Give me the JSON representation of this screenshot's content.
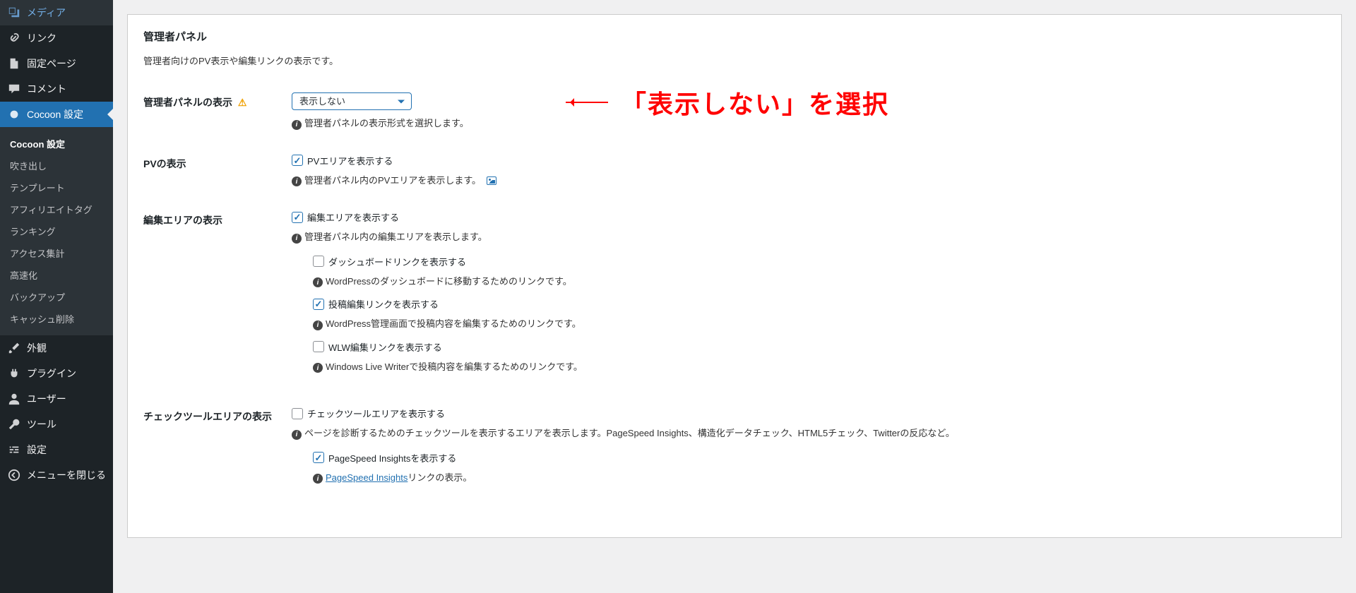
{
  "sidebar": {
    "items": [
      {
        "label": "メディア",
        "icon": "media"
      },
      {
        "label": "リンク",
        "icon": "link"
      },
      {
        "label": "固定ページ",
        "icon": "page"
      },
      {
        "label": "コメント",
        "icon": "comment"
      },
      {
        "label": "Cocoon 設定",
        "icon": "dot",
        "active": true
      },
      {
        "label": "外観",
        "icon": "brush"
      },
      {
        "label": "プラグイン",
        "icon": "plug"
      },
      {
        "label": "ユーザー",
        "icon": "user"
      },
      {
        "label": "ツール",
        "icon": "tool"
      },
      {
        "label": "設定",
        "icon": "settings"
      },
      {
        "label": "メニューを閉じる",
        "icon": "collapse"
      }
    ],
    "submenu": {
      "head": "Cocoon 設定",
      "items": [
        "吹き出し",
        "テンプレート",
        "アフィリエイトタグ",
        "ランキング",
        "アクセス集計",
        "高速化",
        "バックアップ",
        "キャッシュ削除"
      ]
    }
  },
  "panel": {
    "title": "管理者パネル",
    "desc": "管理者向けのPV表示や編集リンクの表示です。"
  },
  "rows": {
    "display": {
      "label": "管理者パネルの表示",
      "select_value": "表示しない",
      "hint": "管理者パネルの表示形式を選択します。"
    },
    "pv": {
      "label": "PVの表示",
      "chk": "PVエリアを表示する",
      "hint": "管理者パネル内のPVエリアを表示します。"
    },
    "edit": {
      "label": "編集エリアの表示",
      "chk": "編集エリアを表示する",
      "hint": "管理者パネル内の編集エリアを表示します。",
      "sub": {
        "dashboard": {
          "chk": "ダッシュボードリンクを表示する",
          "hint": "WordPressのダッシュボードに移動するためのリンクです。"
        },
        "post": {
          "chk": "投稿編集リンクを表示する",
          "hint": "WordPress管理画面で投稿内容を編集するためのリンクです。"
        },
        "wlw": {
          "chk": "WLW編集リンクを表示する",
          "hint": "Windows Live Writerで投稿内容を編集するためのリンクです。"
        }
      }
    },
    "check": {
      "label": "チェックツールエリアの表示",
      "chk": "チェックツールエリアを表示する",
      "hint": "ページを診断するためのチェックツールを表示するエリアを表示します。PageSpeed Insights、構造化データチェック、HTML5チェック、Twitterの反応など。",
      "sub": {
        "psi": {
          "chk": "PageSpeed Insightsを表示する",
          "hint_prefix": "",
          "link": "PageSpeed Insights",
          "hint_suffix": "リンクの表示。"
        }
      }
    }
  },
  "annotation": "「表示しない」を選択"
}
